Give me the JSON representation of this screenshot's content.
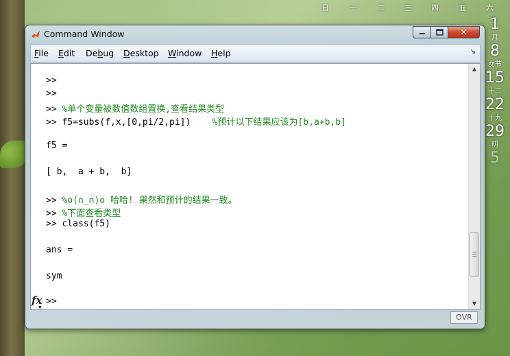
{
  "calendar": {
    "weekdays": [
      "日",
      "一",
      "二",
      "三",
      "四",
      "五",
      "六"
    ],
    "days": [
      "1",
      "8",
      "15",
      "22",
      "29",
      "5"
    ],
    "notes": [
      "月",
      "女节",
      "十二",
      "十九",
      "明"
    ]
  },
  "window": {
    "title": "Command Window",
    "close_symbol": "✕"
  },
  "menu": {
    "items": [
      {
        "accel": "F",
        "rest": "ile"
      },
      {
        "accel": "E",
        "rest": "dit"
      },
      {
        "pre": "De",
        "accel": "b",
        "rest": "ug"
      },
      {
        "accel": "D",
        "rest": "esktop"
      },
      {
        "accel": "W",
        "rest": "indow"
      },
      {
        "accel": "H",
        "rest": "elp"
      }
    ]
  },
  "console": {
    "lines": [
      {
        "code": ">>",
        "comment": ""
      },
      {
        "code": ">>",
        "comment": ""
      },
      {
        "code": ">> ",
        "comment": "%单个变量被数值数组置换,查看结果类型"
      },
      {
        "code": ">> f5=subs(f,x,[0,pi/2,pi])    ",
        "comment": "%预计以下结果应该为[b,a+b,b]"
      },
      {
        "code": "f5 =",
        "comment": ""
      },
      {
        "code": "[ b,  a + b,  b]",
        "comment": ""
      },
      {
        "code": ">> ",
        "comment": "%o(∩_∩)o 哈哈! 果然和预计的结果一致。"
      },
      {
        "code": ">> ",
        "comment": "%下面查看类型"
      },
      {
        "code": ">> class(f5)",
        "comment": ""
      },
      {
        "code": "ans =",
        "comment": ""
      },
      {
        "code": "sym",
        "comment": ""
      },
      {
        "code": ">>",
        "comment": ""
      }
    ],
    "fx_label": "fx"
  },
  "status": {
    "ovr": "OVR"
  }
}
